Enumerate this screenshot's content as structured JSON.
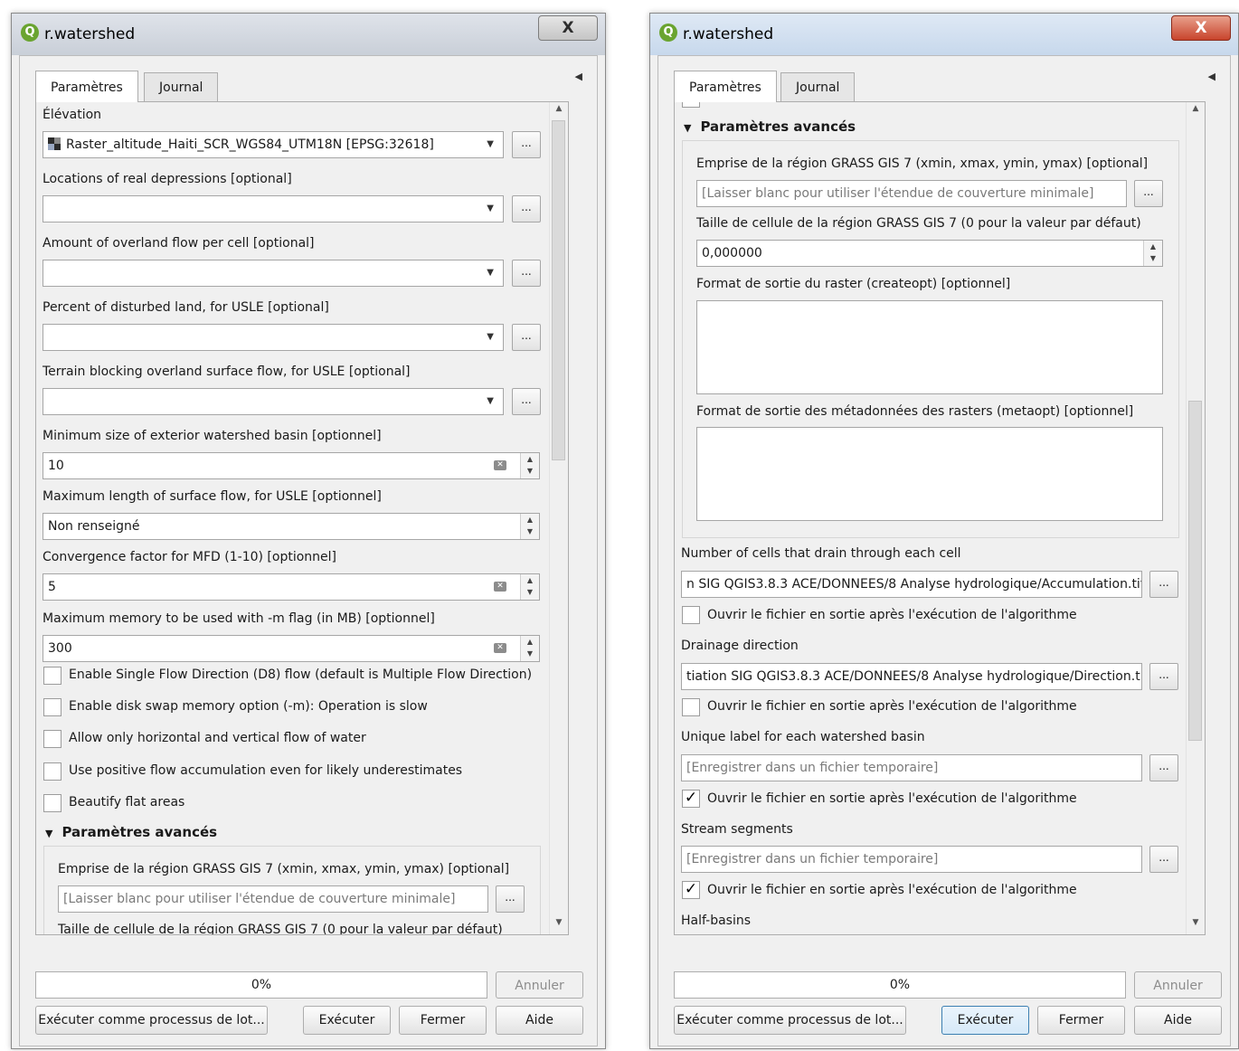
{
  "left": {
    "title": "r.watershed",
    "close_label": "X",
    "tabs": [
      "Paramètres",
      "Journal"
    ],
    "labels": {
      "elevation": "Élévation",
      "depressions": "Locations of real depressions [optional]",
      "overland_flow": "Amount of overland flow per cell [optional]",
      "disturbed": "Percent of disturbed land, for USLE [optional]",
      "blocking": "Terrain blocking overland surface flow, for USLE [optional]",
      "min_size": "Minimum size of exterior watershed basin [optionnel]",
      "max_length": "Maximum length of surface flow, for USLE [optionnel]",
      "convergence": "Convergence factor for MFD (1-10) [optionnel]",
      "memory": "Maximum memory to be used with -m flag (in MB) [optionnel]",
      "advanced": "Paramètres avancés",
      "extent": "Emprise de la région GRASS GIS 7 (xmin, xmax, ymin, ymax) [optional]",
      "cellsize_partial": "Taille de cellule de la région GRASS GIS 7 (0 pour la valeur par défaut)"
    },
    "values": {
      "elevation": "Raster_altitude_Haiti_SCR_WGS84_UTM18N [EPSG:32618]",
      "min_size": "10",
      "max_length": "Non renseigné",
      "convergence": "5",
      "memory": "300",
      "extent_placeholder": "[Laisser blanc pour utiliser l'étendue de couverture minimale]"
    },
    "checkboxes": [
      {
        "label": "Enable Single Flow Direction (D8) flow (default is Multiple Flow Direction)",
        "checked": false
      },
      {
        "label": "Enable disk swap memory option (-m): Operation is slow",
        "checked": false
      },
      {
        "label": "Allow only horizontal and vertical flow of water",
        "checked": false
      },
      {
        "label": "Use positive flow accumulation even for likely underestimates",
        "checked": false
      },
      {
        "label": "Beautify flat areas",
        "checked": false
      }
    ],
    "browse_label": "...",
    "progress": "0%",
    "buttons": {
      "cancel": "Annuler",
      "batch": "Exécuter comme processus de lot...",
      "run": "Exécuter",
      "close": "Fermer",
      "help": "Aide"
    }
  },
  "right": {
    "title": "r.watershed",
    "close_label": "X",
    "tabs": [
      "Paramètres",
      "Journal"
    ],
    "labels": {
      "advanced": "Paramètres avancés",
      "extent": "Emprise de la région GRASS GIS 7 (xmin, xmax, ymin, ymax) [optional]",
      "cellsize": "Taille de cellule de la région GRASS GIS 7 (0 pour la valeur par défaut)",
      "createopt": "Format de sortie du raster (createopt) [optionnel]",
      "metaopt": "Format de sortie des métadonnées des rasters (metaopt) [optionnel]",
      "accumulation": "Number of cells that drain through each cell",
      "drainage": "Drainage direction",
      "basin": "Unique label for each watershed basin",
      "stream": "Stream segments",
      "half_basins": "Half-basins"
    },
    "values": {
      "extent_placeholder": "[Laisser blanc pour utiliser l'étendue de couverture minimale]",
      "cellsize": "0,000000",
      "accumulation_path": "n SIG QGIS3.8.3 ACE/DONNEES/8 Analyse hydrologique/Accumulation.tif",
      "drainage_path": "tiation SIG QGIS3.8.3 ACE/DONNEES/8 Analyse hydrologique/Direction.tif",
      "basin_placeholder": "[Enregistrer dans un fichier temporaire]",
      "stream_placeholder": "[Enregistrer dans un fichier temporaire]"
    },
    "open_output_label": "Ouvrir le fichier en sortie après l'exécution de l'algorithme",
    "open_output_checked": [
      false,
      false,
      true,
      true
    ],
    "check_mark": "✓",
    "browse_label": "...",
    "progress": "0%",
    "buttons": {
      "cancel": "Annuler",
      "batch": "Exécuter comme processus de lot...",
      "run": "Exécuter",
      "close": "Fermer",
      "help": "Aide"
    }
  }
}
